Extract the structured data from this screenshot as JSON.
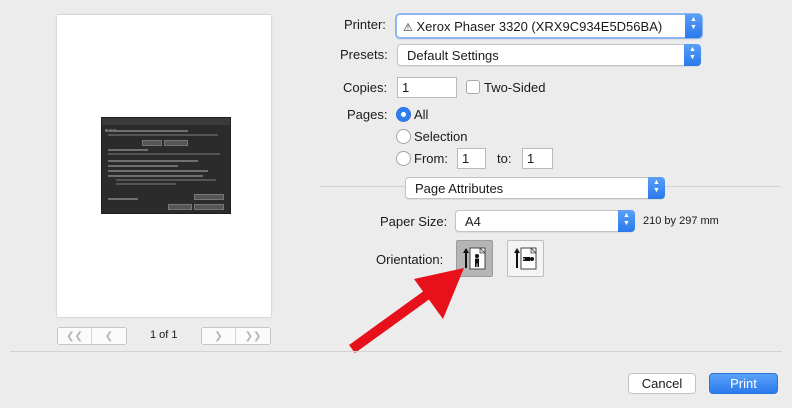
{
  "printer": {
    "label": "Printer:",
    "value": "Xerox Phaser 3320 (XRX9C934E5D56BA)",
    "warning_icon": "warning-triangle-icon"
  },
  "presets": {
    "label": "Presets:",
    "value": "Default Settings"
  },
  "copies": {
    "label": "Copies:",
    "value": "1",
    "two_sided_label": "Two-Sided",
    "two_sided_checked": false
  },
  "pages": {
    "label": "Pages:",
    "options": [
      "All",
      "Selection",
      "From:"
    ],
    "selected": "All",
    "from_value": "1",
    "to_label": "to:",
    "to_value": "1"
  },
  "section_popup": {
    "value": "Page Attributes"
  },
  "paper_size": {
    "label": "Paper Size:",
    "value": "A4",
    "dimensions": "210 by 297 mm"
  },
  "orientation": {
    "label": "Orientation:",
    "options": [
      "portrait-orientation-icon",
      "landscape-orientation-icon"
    ],
    "selected": "portrait"
  },
  "preview": {
    "page_count": "1 of 1"
  },
  "pager_icons": [
    "first-page-icon",
    "previous-page-icon",
    "next-page-icon",
    "last-page-icon"
  ],
  "actions": {
    "cancel_label": "Cancel",
    "print_label": "Print"
  },
  "colors": {
    "accent": "#2f7ef0",
    "background": "#ececec",
    "annotation_arrow": "#e8101a"
  }
}
